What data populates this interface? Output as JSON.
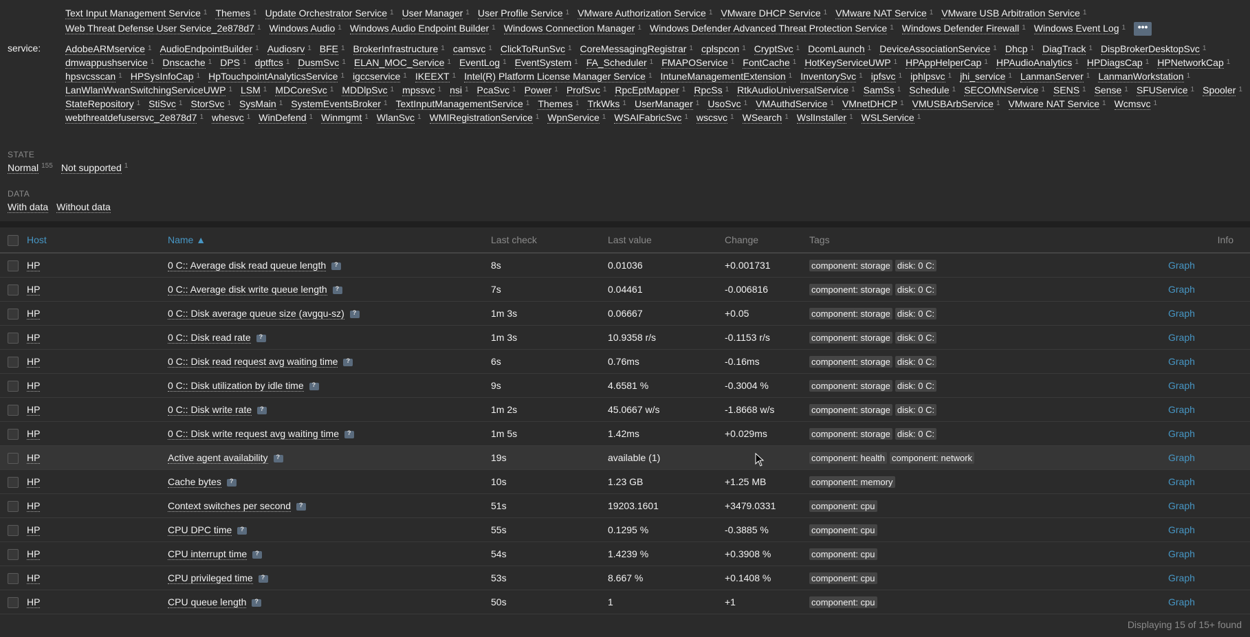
{
  "filters": {
    "top_partial_line": [
      "Text Input Management Service",
      "Themes",
      "Update Orchestrator Service",
      "User Manager",
      "User Profile Service",
      "VMware Authorization Service",
      "VMware DHCP Service",
      "VMware NAT Service",
      "VMware USB Arbitration Service"
    ],
    "top_line2": [
      "Web Threat Defense User Service_2e878d7",
      "Windows Audio",
      "Windows Audio Endpoint Builder",
      "Windows Connection Manager",
      "Windows Defender Advanced Threat Protection Service",
      "Windows Defender Firewall",
      "Windows Event Log"
    ],
    "more_label": "•••",
    "service_label": "service:",
    "service_lines": [
      [
        "AdobeARMservice",
        "AudioEndpointBuilder",
        "Audiosrv",
        "BFE",
        "BrokerInfrastructure",
        "camsvc",
        "ClickToRunSvc",
        "CoreMessagingRegistrar",
        "cplspcon",
        "CryptSvc",
        "DcomLaunch",
        "DeviceAssociationService",
        "Dhcp",
        "DiagTrack",
        "DispBrokerDesktopSvc"
      ],
      [
        "dmwappushservice",
        "Dnscache",
        "DPS",
        "dptftcs",
        "DusmSvc",
        "ELAN_MOC_Service",
        "EventLog",
        "EventSystem",
        "FA_Scheduler",
        "FMAPOService",
        "FontCache",
        "HotKeyServiceUWP",
        "HPAppHelperCap",
        "HPAudioAnalytics",
        "HPDiagsCap",
        "HPNetworkCap"
      ],
      [
        "hpsvcsscan",
        "HPSysInfoCap",
        "HpTouchpointAnalyticsService",
        "igccservice",
        "IKEEXT",
        "Intel(R) Platform License Manager Service",
        "IntuneManagementExtension",
        "InventorySvc",
        "ipfsvc",
        "iphlpsvc",
        "jhi_service",
        "LanmanServer",
        "LanmanWorkstation"
      ],
      [
        "LanWlanWwanSwitchingServiceUWP",
        "LSM",
        "MDCoreSvc",
        "MDDlpSvc",
        "mpssvc",
        "nsi",
        "PcaSvc",
        "Power",
        "ProfSvc",
        "RpcEptMapper",
        "RpcSs",
        "RtkAudioUniversalService",
        "SamSs",
        "Schedule",
        "SECOMNService",
        "SENS",
        "Sense",
        "SFUService",
        "Spooler"
      ],
      [
        "StateRepository",
        "StiSvc",
        "StorSvc",
        "SysMain",
        "SystemEventsBroker",
        "TextInputManagementService",
        "Themes",
        "TrkWks",
        "UserManager",
        "UsoSvc",
        "VMAuthdService",
        "VMnetDHCP",
        "VMUSBArbService",
        "VMware NAT Service",
        "Wcmsvc"
      ],
      [
        "webthreatdefusersvc_2e878d7",
        "whesvc",
        "WinDefend",
        "Winmgmt",
        "WlanSvc",
        "WMIRegistrationService",
        "WpnService",
        "WSAIFabricSvc",
        "wscsvc",
        "WSearch",
        "WslInstaller",
        "WSLService"
      ]
    ],
    "count_one": "1",
    "state_label": "STATE",
    "state_items": [
      {
        "label": "Normal",
        "count": "155"
      },
      {
        "label": "Not supported",
        "count": "1"
      }
    ],
    "data_label": "DATA",
    "data_items": [
      "With data",
      "Without data"
    ]
  },
  "table": {
    "headers": {
      "host": "Host",
      "name": "Name ▲",
      "last_check": "Last check",
      "last_value": "Last value",
      "change": "Change",
      "tags": "Tags",
      "info": "Info"
    },
    "rows": [
      {
        "host": "HP",
        "name": "0 C:: Average disk read queue length",
        "last_check": "8s",
        "last_value": "0.01036",
        "change": "+0.001731",
        "tags": [
          "component: storage",
          "disk: 0 C:"
        ],
        "graph": "Graph"
      },
      {
        "host": "HP",
        "name": "0 C:: Average disk write queue length",
        "last_check": "7s",
        "last_value": "0.04461",
        "change": "-0.006816",
        "tags": [
          "component: storage",
          "disk: 0 C:"
        ],
        "graph": "Graph"
      },
      {
        "host": "HP",
        "name": "0 C:: Disk average queue size (avgqu-sz)",
        "last_check": "1m 3s",
        "last_value": "0.06667",
        "change": "+0.05",
        "tags": [
          "component: storage",
          "disk: 0 C:"
        ],
        "graph": "Graph"
      },
      {
        "host": "HP",
        "name": "0 C:: Disk read rate",
        "last_check": "1m 3s",
        "last_value": "10.9358 r/s",
        "change": "-0.1153 r/s",
        "tags": [
          "component: storage",
          "disk: 0 C:"
        ],
        "graph": "Graph"
      },
      {
        "host": "HP",
        "name": "0 C:: Disk read request avg waiting time",
        "last_check": "6s",
        "last_value": "0.76ms",
        "change": "-0.16ms",
        "tags": [
          "component: storage",
          "disk: 0 C:"
        ],
        "graph": "Graph"
      },
      {
        "host": "HP",
        "name": "0 C:: Disk utilization by idle time",
        "last_check": "9s",
        "last_value": "4.6581 %",
        "change": "-0.3004 %",
        "tags": [
          "component: storage",
          "disk: 0 C:"
        ],
        "graph": "Graph"
      },
      {
        "host": "HP",
        "name": "0 C:: Disk write rate",
        "last_check": "1m 2s",
        "last_value": "45.0667 w/s",
        "change": "-1.8668 w/s",
        "tags": [
          "component: storage",
          "disk: 0 C:"
        ],
        "graph": "Graph"
      },
      {
        "host": "HP",
        "name": "0 C:: Disk write request avg waiting time",
        "last_check": "1m 5s",
        "last_value": "1.42ms",
        "change": "+0.029ms",
        "tags": [
          "component: storage",
          "disk: 0 C:"
        ],
        "graph": "Graph"
      },
      {
        "host": "HP",
        "name": "Active agent availability",
        "last_check": "19s",
        "last_value": "available (1)",
        "change": "",
        "tags": [
          "component: health",
          "component: network"
        ],
        "graph": "Graph"
      },
      {
        "host": "HP",
        "name": "Cache bytes",
        "last_check": "10s",
        "last_value": "1.23 GB",
        "change": "+1.25 MB",
        "tags": [
          "component: memory"
        ],
        "graph": "Graph"
      },
      {
        "host": "HP",
        "name": "Context switches per second",
        "last_check": "51s",
        "last_value": "19203.1601",
        "change": "+3479.0331",
        "tags": [
          "component: cpu"
        ],
        "graph": "Graph"
      },
      {
        "host": "HP",
        "name": "CPU DPC time",
        "last_check": "55s",
        "last_value": "0.1295 %",
        "change": "-0.3885 %",
        "tags": [
          "component: cpu"
        ],
        "graph": "Graph"
      },
      {
        "host": "HP",
        "name": "CPU interrupt time",
        "last_check": "54s",
        "last_value": "1.4239 %",
        "change": "+0.3908 %",
        "tags": [
          "component: cpu"
        ],
        "graph": "Graph"
      },
      {
        "host": "HP",
        "name": "CPU privileged time",
        "last_check": "53s",
        "last_value": "8.667 %",
        "change": "+0.1408 %",
        "tags": [
          "component: cpu"
        ],
        "graph": "Graph"
      },
      {
        "host": "HP",
        "name": "CPU queue length",
        "last_check": "50s",
        "last_value": "1",
        "change": "+1",
        "tags": [
          "component: cpu"
        ],
        "graph": "Graph"
      }
    ],
    "footer": "Displaying 15 of 15+ found"
  }
}
